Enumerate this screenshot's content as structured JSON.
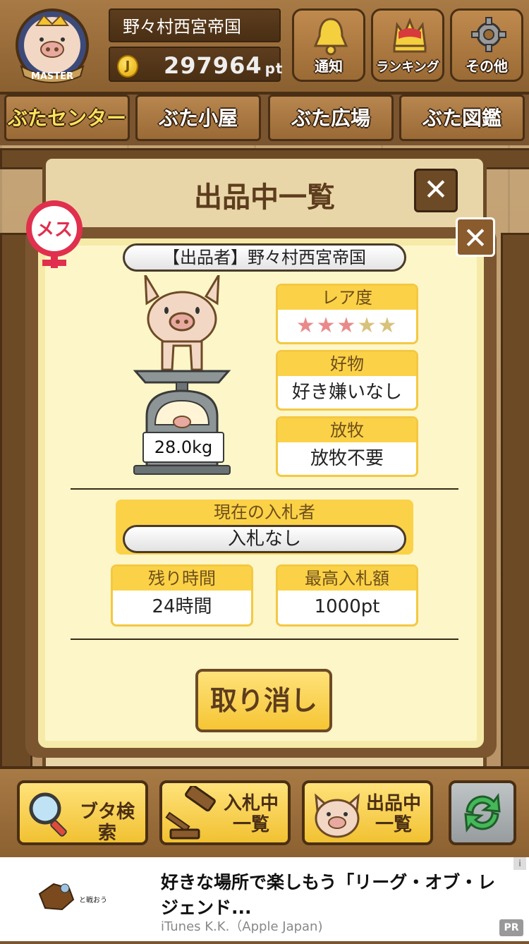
{
  "header": {
    "user_name": "野々村西宮帝国",
    "points_value": "297964",
    "points_unit": "pt",
    "badge_label": "MASTER",
    "buttons": [
      {
        "label": "通知",
        "icon": "bell-icon"
      },
      {
        "label": "ランキング",
        "icon": "crown-icon"
      },
      {
        "label": "その他",
        "icon": "gear-icon"
      }
    ]
  },
  "tabs": [
    {
      "label": "ぶたセンター",
      "active": true
    },
    {
      "label": "ぶた小屋",
      "active": false
    },
    {
      "label": "ぶた広場",
      "active": false
    },
    {
      "label": "ぶた図鑑",
      "active": false
    }
  ],
  "list_dialog": {
    "title": "出品中一覧",
    "close": "✕"
  },
  "detail": {
    "gender_label": "メス",
    "close": "✕",
    "seller": "【出品者】野々村西宮帝国",
    "weight": "28.0kg",
    "rarity": {
      "label": "レア度",
      "stars_filled": 3,
      "stars_total": 5
    },
    "favorite": {
      "label": "好物",
      "value": "好き嫌いなし"
    },
    "grazing": {
      "label": "放牧",
      "value": "放牧不要"
    },
    "bidder": {
      "label": "現在の入札者",
      "value": "入札なし"
    },
    "time_left": {
      "label": "残り時間",
      "value": "24時間"
    },
    "max_bid": {
      "label": "最高入札額",
      "value": "1000pt"
    },
    "cancel_label": "取り消し"
  },
  "bottom_bar": {
    "search_label": "ブタ検索",
    "bidding_label_1": "入札中",
    "bidding_label_2": "一覧",
    "listing_label_1": "出品中",
    "listing_label_2": "一覧"
  },
  "ad": {
    "image_caption": "と戦おう",
    "title": "好きな場所で楽しもう「リーグ・オブ・レジェンド...",
    "advertiser": "iTunes K.K.（Apple Japan)",
    "info": "i",
    "pr": "PR"
  }
}
